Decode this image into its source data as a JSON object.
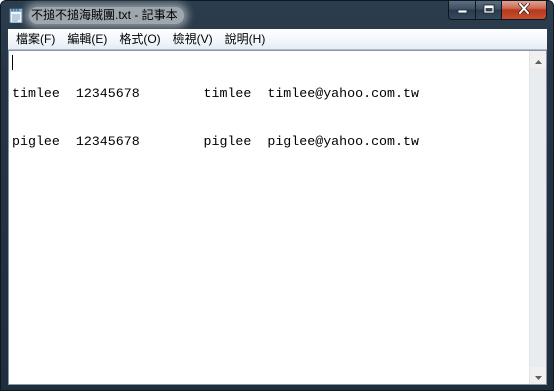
{
  "window": {
    "title": "不搥不搥海賊團.txt - 記事本",
    "icons": {
      "app": "notepad-icon",
      "minimize": "minimize-icon",
      "maximize": "maximize-icon",
      "close": "close-icon"
    },
    "colors": {
      "frame": "#253545",
      "close_button": "#c74f2f"
    }
  },
  "menu": {
    "items": [
      {
        "label": "檔案(F)"
      },
      {
        "label": "編輯(E)"
      },
      {
        "label": "格式(O)"
      },
      {
        "label": "檢視(V)"
      },
      {
        "label": "說明(H)"
      }
    ]
  },
  "editor": {
    "lines": [
      "timlee  12345678        timlee  timlee@yahoo.com.tw",
      "piglee  12345678        piglee  piglee@yahoo.com.tw"
    ],
    "scrollbar": {
      "up_icon": "arrow-up-icon",
      "down_icon": "arrow-down-icon"
    }
  }
}
